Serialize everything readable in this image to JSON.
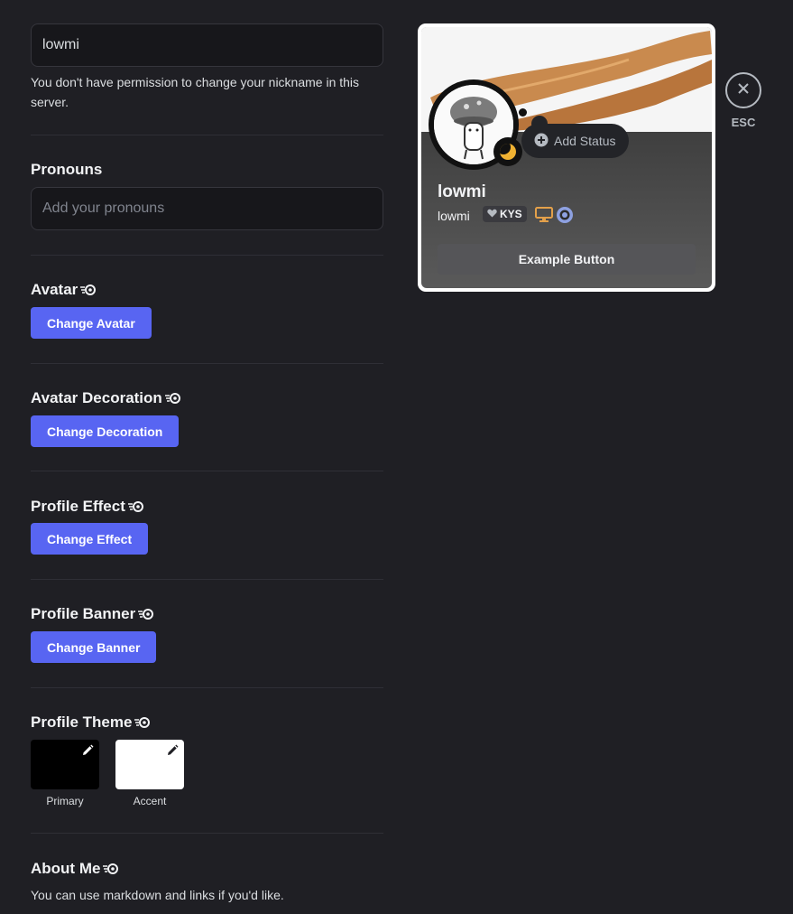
{
  "nickname": {
    "value": "lowmi",
    "note": "You don't have permission to change your nickname in this server."
  },
  "pronouns": {
    "label": "Pronouns",
    "placeholder": "Add your pronouns"
  },
  "avatar": {
    "label": "Avatar",
    "button": "Change Avatar"
  },
  "decoration": {
    "label": "Avatar Decoration",
    "button": "Change Decoration"
  },
  "effect": {
    "label": "Profile Effect",
    "button": "Change Effect"
  },
  "banner": {
    "label": "Profile Banner",
    "button": "Change Banner"
  },
  "theme": {
    "label": "Profile Theme",
    "primary_label": "Primary",
    "accent_label": "Accent",
    "primary_color": "#000000",
    "accent_color": "#ffffff"
  },
  "about": {
    "label": "About Me",
    "note": "You can use markdown and links if you'd like."
  },
  "preview": {
    "add_status": "Add Status",
    "display_name": "lowmi",
    "username": "lowmi",
    "tag": "KYS",
    "example_button": "Example Button",
    "status": "idle"
  },
  "close": {
    "label": "ESC"
  },
  "colors": {
    "accent": "#5865f2",
    "background": "#1f1f24"
  }
}
